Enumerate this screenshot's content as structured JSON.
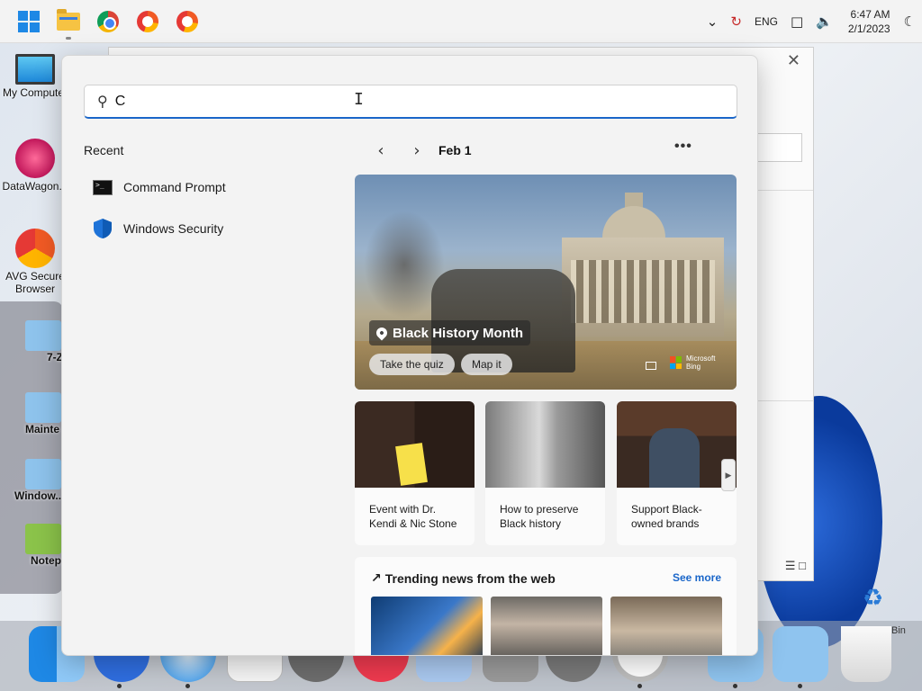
{
  "taskbar": {
    "icons": [
      "start-windows-icon",
      "file-explorer-icon",
      "chrome-icon",
      "avg-secure-browser-icon",
      "avg-secure-browser-icon-2"
    ],
    "tray": {
      "language": "ENG",
      "time": "6:47 AM",
      "date": "2/1/2023"
    }
  },
  "desktop": {
    "icons": [
      {
        "label": "My Computer"
      },
      {
        "label": "DataWagon..."
      },
      {
        "label": "AVG Secure Browser"
      }
    ],
    "side_items": [
      {
        "label": "7-Z"
      },
      {
        "label": "Mainte"
      },
      {
        "label": "Window..."
      },
      {
        "label": "Notep"
      }
    ],
    "recycle_label": "Bin"
  },
  "search": {
    "value": "C",
    "placeholder": ""
  },
  "recent": {
    "title": "Recent",
    "items": [
      {
        "label": "Command Prompt",
        "icon": "command-prompt-icon"
      },
      {
        "label": "Windows Security",
        "icon": "windows-security-shield-icon"
      }
    ]
  },
  "highlights": {
    "date": "Feb 1",
    "more": "•••",
    "hero": {
      "title": "Black History Month",
      "actions": [
        "Take the quiz",
        "Map it"
      ],
      "brand": "Microsoft Bing"
    },
    "cards": [
      {
        "caption": "Event with Dr. Kendi & Nic Stone"
      },
      {
        "caption": "How to preserve Black history"
      },
      {
        "caption": "Support Black-owned brands"
      }
    ],
    "trending": {
      "title": "Trending news from the web",
      "see_more": "See more"
    }
  },
  "colors": {
    "accent": "#1a66c9",
    "panel_bg": "#f3f3f3"
  }
}
